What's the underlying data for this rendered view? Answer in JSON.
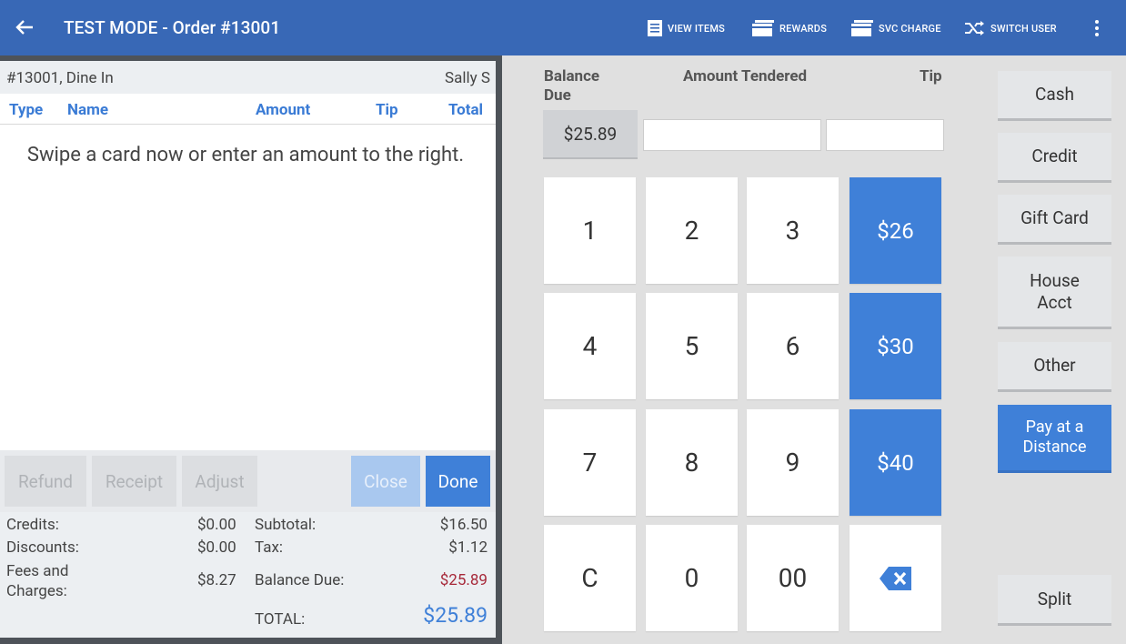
{
  "app": {
    "title": "TEST MODE - Order #13001",
    "actions": {
      "view_items": "VIEW ITEMS",
      "rewards": "REWARDS",
      "svc_charge": "SVC CHARGE",
      "switch_user": "SWITCH USER"
    }
  },
  "order": {
    "label": "#13001, Dine In",
    "server": "Sally S",
    "columns": [
      "Type",
      "Name",
      "Amount",
      "Tip",
      "Total"
    ],
    "message": "Swipe a card now or enter an amount to the right."
  },
  "actions": {
    "refund": "Refund",
    "receipt": "Receipt",
    "adjust": "Adjust",
    "close": "Close",
    "done": "Done"
  },
  "totals": {
    "credits_label": "Credits:",
    "credits": "$0.00",
    "discounts_label": "Discounts:",
    "discounts": "$0.00",
    "fees_label": "Fees and Charges:",
    "fees": "$8.27",
    "subtotal_label": "Subtotal:",
    "subtotal": "$16.50",
    "tax_label": "Tax:",
    "tax": "$1.12",
    "balance_label": "Balance Due:",
    "balance": "$25.89",
    "total_label": "TOTAL:",
    "total": "$25.89"
  },
  "tender": {
    "balance_due_label": "Balance Due",
    "amount_tendered_label": "Amount Tendered",
    "tip_label": "Tip",
    "balance_due": "$25.89",
    "amount_tendered": "",
    "tip": ""
  },
  "keypad": {
    "k1": "1",
    "k2": "2",
    "k3": "3",
    "q1": "$26",
    "k4": "4",
    "k5": "5",
    "k6": "6",
    "q2": "$30",
    "k7": "7",
    "k8": "8",
    "k9": "9",
    "q3": "$40",
    "clear": "C",
    "k0": "0",
    "k00": "00"
  },
  "payment_types": {
    "cash": "Cash",
    "credit": "Credit",
    "gift_card": "Gift Card",
    "house_acct": "House Acct",
    "other": "Other",
    "pay_at_distance": "Pay at a Distance",
    "split": "Split"
  },
  "colors": {
    "topbar": "#3868b6",
    "accent": "#3f80d8",
    "balance_red": "#a7293a"
  }
}
